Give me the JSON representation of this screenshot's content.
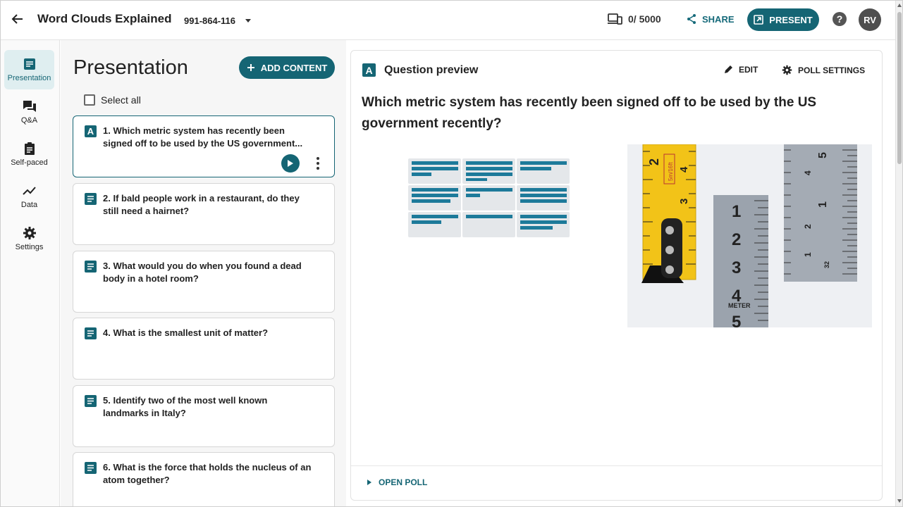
{
  "header": {
    "title": "Word Clouds Explained",
    "code": "991-864-116",
    "counter": "0/ 5000",
    "share_label": "SHARE",
    "present_label": "PRESENT",
    "help_label": "?",
    "avatar_initials": "RV"
  },
  "nav": {
    "items": [
      {
        "label": "Presentation",
        "icon": "presentation-icon",
        "active": true
      },
      {
        "label": "Q&A",
        "icon": "chat-icon",
        "active": false
      },
      {
        "label": "Self-paced",
        "icon": "clipboard-icon",
        "active": false
      },
      {
        "label": "Data",
        "icon": "trend-icon",
        "active": false
      },
      {
        "label": "Settings",
        "icon": "gear-icon",
        "active": false
      }
    ]
  },
  "presentation": {
    "heading": "Presentation",
    "add_label": "ADD CONTENT",
    "select_all_label": "Select all",
    "cards": [
      {
        "text": "1. Which metric system has recently been signed off to be used by the US government...",
        "icon": "letter-a-icon",
        "icon_letter": "A",
        "selected": true
      },
      {
        "text": "2. If bald people work in a restaurant, do they still need a hairnet?",
        "icon": "text-lines-icon",
        "selected": false
      },
      {
        "text": "3. What would you do when you found a dead body in a hotel room?",
        "icon": "text-lines-icon",
        "selected": false
      },
      {
        "text": "4. What is the smallest unit of matter?",
        "icon": "text-lines-icon",
        "selected": false
      },
      {
        "text": "5. Identify two of the most well known landmarks in Italy?",
        "icon": "text-lines-icon",
        "selected": false
      },
      {
        "text": "6. What is the force that holds the nucleus of an atom together?",
        "icon": "text-lines-icon",
        "selected": false
      }
    ]
  },
  "preview": {
    "icon_letter": "A",
    "title": "Question preview",
    "edit_label": "EDIT",
    "poll_settings_label": "POLL SETTINGS",
    "question": "Which metric system has recently been signed off to be used by the US government recently?",
    "open_poll_label": "OPEN POLL",
    "photo_labels": {
      "tape_text": "5m/16ft",
      "meter_label": "METER"
    }
  },
  "colors": {
    "brand": "#156574",
    "active_nav_bg": "#dfeef0"
  }
}
